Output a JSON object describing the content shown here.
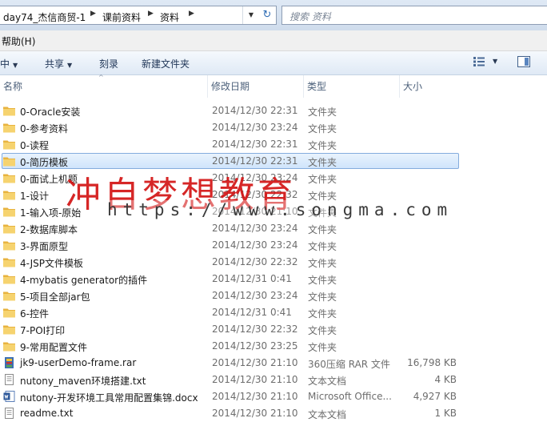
{
  "address": {
    "crumbs": [
      "day74_杰信商贸-1",
      "课前资料",
      "资料"
    ],
    "search_placeholder": "搜索 资料"
  },
  "menu": {
    "help_label": "帮助(H)"
  },
  "toolbar": {
    "organize_label": "中",
    "share_label": "共享",
    "burn_label": "刻录",
    "new_folder_label": "新建文件夹"
  },
  "columns": {
    "name": "名称",
    "modified": "修改日期",
    "type": "类型",
    "size": "大小"
  },
  "files": [
    {
      "name": "0-Oracle安装",
      "modified": "2014/12/30 22:31",
      "type": "文件夹",
      "size": "",
      "icon": "folder-icon"
    },
    {
      "name": "0-参考资料",
      "modified": "2014/12/30 23:24",
      "type": "文件夹",
      "size": "",
      "icon": "folder-icon"
    },
    {
      "name": "0-读程",
      "modified": "2014/12/30 22:31",
      "type": "文件夹",
      "size": "",
      "icon": "folder-icon"
    },
    {
      "name": "0-简历模板",
      "modified": "2014/12/30 22:31",
      "type": "文件夹",
      "size": "",
      "icon": "folder-icon",
      "selected": true
    },
    {
      "name": "0-面试上机题",
      "modified": "2014/12/30 23:24",
      "type": "文件夹",
      "size": "",
      "icon": "folder-icon"
    },
    {
      "name": "1-设计",
      "modified": "2014/12/30 22:32",
      "type": "文件夹",
      "size": "",
      "icon": "folder-icon"
    },
    {
      "name": "1-输入项-原始",
      "modified": "2014/12/30 21:10",
      "type": "文件夹",
      "size": "",
      "icon": "folder-icon"
    },
    {
      "name": "2-数据库脚本",
      "modified": "2014/12/30 23:24",
      "type": "文件夹",
      "size": "",
      "icon": "folder-icon"
    },
    {
      "name": "3-界面原型",
      "modified": "2014/12/30 23:24",
      "type": "文件夹",
      "size": "",
      "icon": "folder-icon"
    },
    {
      "name": "4-JSP文件模板",
      "modified": "2014/12/30 22:32",
      "type": "文件夹",
      "size": "",
      "icon": "folder-icon"
    },
    {
      "name": "4-mybatis generator的插件",
      "modified": "2014/12/31 0:41",
      "type": "文件夹",
      "size": "",
      "icon": "folder-icon"
    },
    {
      "name": "5-项目全部jar包",
      "modified": "2014/12/30 23:24",
      "type": "文件夹",
      "size": "",
      "icon": "folder-icon"
    },
    {
      "name": "6-控件",
      "modified": "2014/12/31 0:41",
      "type": "文件夹",
      "size": "",
      "icon": "folder-icon"
    },
    {
      "name": "7-POI打印",
      "modified": "2014/12/30 22:32",
      "type": "文件夹",
      "size": "",
      "icon": "folder-icon"
    },
    {
      "name": "9-常用配置文件",
      "modified": "2014/12/30 23:25",
      "type": "文件夹",
      "size": "",
      "icon": "folder-icon"
    },
    {
      "name": "jk9-userDemo-frame.rar",
      "modified": "2014/12/30 21:10",
      "type": "360压缩 RAR 文件",
      "size": "16,798 KB",
      "icon": "rar-archive-icon"
    },
    {
      "name": "nutony_maven环境搭建.txt",
      "modified": "2014/12/30 21:10",
      "type": "文本文档",
      "size": "4 KB",
      "icon": "text-file-icon"
    },
    {
      "name": "nutony-开发环境工具常用配置集锦.docx",
      "modified": "2014/12/30 21:10",
      "type": "Microsoft Office...",
      "size": "4,927 KB",
      "icon": "word-doc-icon"
    },
    {
      "name": "readme.txt",
      "modified": "2014/12/30 21:10",
      "type": "文本文档",
      "size": "1 KB",
      "icon": "text-file-icon"
    }
  ],
  "watermark": {
    "red_text": "冲自梦想教育",
    "url_text": "https://www.songma.com"
  },
  "colors": {
    "selection_border": "#84acdd",
    "folder": "#f2c55c",
    "watermark_red": "#d21414"
  }
}
